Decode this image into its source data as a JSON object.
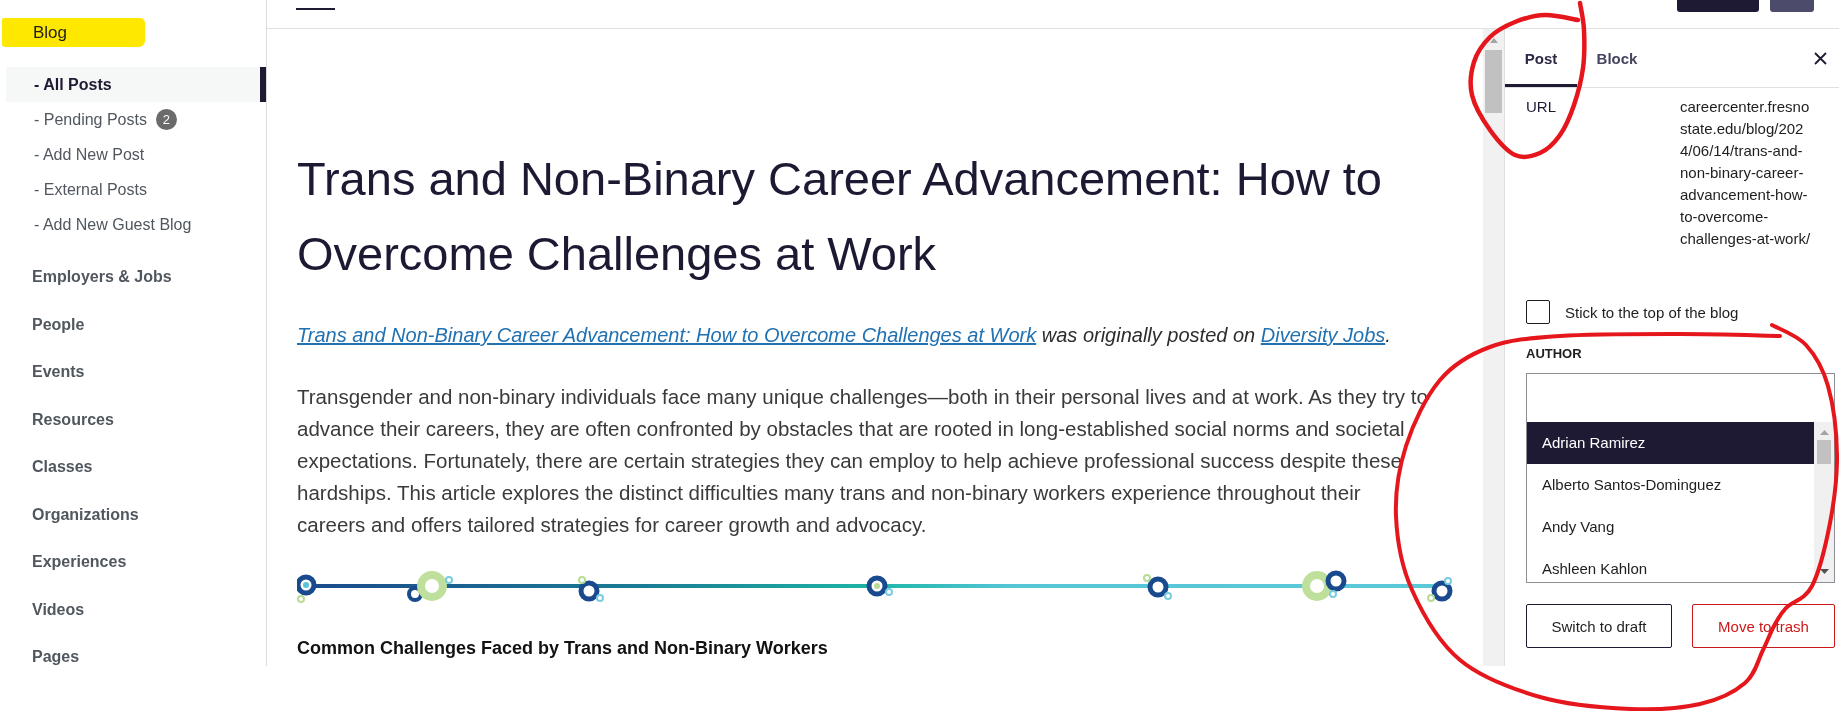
{
  "sidebar": {
    "heading": "Blog",
    "subitems": [
      {
        "label": "- All Posts",
        "selected": true
      },
      {
        "label": "- Pending Posts",
        "selected": false,
        "badge": "2"
      },
      {
        "label": "- Add New Post",
        "selected": false
      },
      {
        "label": "- External Posts",
        "selected": false
      },
      {
        "label": "- Add New Guest Blog",
        "selected": false
      }
    ],
    "items": [
      "Employers & Jobs",
      "People",
      "Events",
      "Resources",
      "Classes",
      "Organizations",
      "Experiences",
      "Videos",
      "Pages"
    ]
  },
  "post": {
    "title": "Trans and Non-Binary Career Advancement: How to Overcome Challenges at Work",
    "source_credit": [
      {
        "kind": "link",
        "text": "Trans and Non-Binary Career Advancement: How to Overcome Challenges at Work"
      },
      {
        "kind": "text",
        "text": " was originally posted on "
      },
      {
        "kind": "link",
        "text": "Diversity Jobs"
      },
      {
        "kind": "text",
        "text": "."
      }
    ],
    "paragraph": "Transgender and non-binary individuals face many unique challenges—both in their personal lives and at work. As they try to advance their careers, they are often confronted by obstacles that are rooted in long-established social norms and societal expectations. Fortunately, there are certain strategies they can employ to help achieve professional success despite these hardships. This article explores the distinct difficulties many trans and non-binary workers experience throughout their careers and offers tailored strategies for career growth and advocacy.",
    "subheading": "Common Challenges Faced by Trans and Non-Binary Workers"
  },
  "settings_panel": {
    "tabs": [
      {
        "label": "Post",
        "selected": true
      },
      {
        "label": "Block",
        "selected": false
      }
    ],
    "url": {
      "label": "URL",
      "value": "careercenter.fresnostate.edu/blog/2024/06/14/trans-and-non-binary-career-advancement-how-to-overcome-challenges-at-work/"
    },
    "sticky": {
      "label": "Stick to the top of the blog",
      "checked": false
    },
    "author": {
      "label": "AUTHOR",
      "options": [
        {
          "name": "Adrian Ramirez",
          "selected": true
        },
        {
          "name": "Alberto Santos-Dominguez",
          "selected": false
        },
        {
          "name": "Andy Vang",
          "selected": false
        },
        {
          "name": "Ashleen Kahlon",
          "selected": false
        }
      ]
    },
    "actions": [
      {
        "label": "Switch to draft",
        "kind": "secondary"
      },
      {
        "label": "Move to trash",
        "kind": "destructive"
      }
    ]
  }
}
